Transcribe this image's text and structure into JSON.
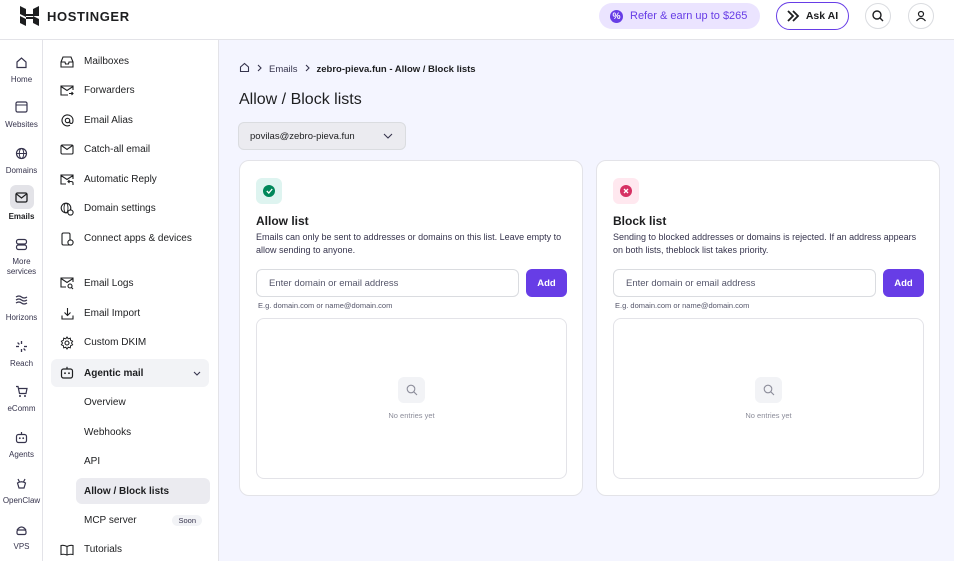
{
  "app": {
    "brand": "HOSTINGER",
    "refer_label": "Refer & earn up to $265",
    "ask_ai_label": "Ask AI",
    "accent": "#673de6"
  },
  "rail": [
    {
      "label": "Home",
      "icon": "home-icon"
    },
    {
      "label": "Websites",
      "icon": "browser-icon"
    },
    {
      "label": "Domains",
      "icon": "globe-icon"
    },
    {
      "label": "Emails",
      "icon": "mail-icon",
      "active": true
    },
    {
      "label": "More services",
      "icon": "server-icon"
    },
    {
      "label": "Horizons",
      "icon": "horizons-icon"
    },
    {
      "label": "Reach",
      "icon": "reach-icon"
    },
    {
      "label": "eComm",
      "icon": "cart-icon"
    },
    {
      "label": "Agents",
      "icon": "robot-icon"
    },
    {
      "label": "OpenClaw",
      "icon": "claw-icon"
    },
    {
      "label": "VPS",
      "icon": "vps-icon"
    }
  ],
  "sidebar": {
    "items": [
      {
        "label": "Mailboxes",
        "icon": "inbox-icon"
      },
      {
        "label": "Forwarders",
        "icon": "forward-mail-icon"
      },
      {
        "label": "Email Alias",
        "icon": "at-icon"
      },
      {
        "label": "Catch-all email",
        "icon": "envelope-icon"
      },
      {
        "label": "Automatic Reply",
        "icon": "reply-icon"
      },
      {
        "label": "Domain settings",
        "icon": "globe-gear-icon"
      },
      {
        "label": "Connect apps & devices",
        "icon": "devices-icon"
      },
      {
        "label": "Email Logs",
        "icon": "mail-search-icon"
      },
      {
        "label": "Email Import",
        "icon": "download-icon"
      },
      {
        "label": "Custom DKIM",
        "icon": "gear-icon"
      }
    ],
    "group": {
      "label": "Agentic mail",
      "icon": "robot-mail-icon"
    },
    "sub_items": [
      {
        "label": "Overview"
      },
      {
        "label": "Webhooks"
      },
      {
        "label": "API"
      },
      {
        "label": "Allow / Block lists",
        "active": true
      },
      {
        "label": "MCP server",
        "badge": "Soon"
      }
    ],
    "tutorials": {
      "label": "Tutorials",
      "icon": "book-icon"
    }
  },
  "breadcrumb": {
    "emails": "Emails",
    "current": "zebro-pieva.fun - Allow / Block lists"
  },
  "page_title": "Allow / Block lists",
  "mailbox_select": {
    "value": "povilas@zebro-pieva.fun"
  },
  "allow": {
    "title": "Allow list",
    "description": "Emails can only be sent to addresses or domains on this list. Leave empty to allow sending to anyone.",
    "placeholder": "Enter domain or email address",
    "add_label": "Add",
    "hint": "E.g. domain.com or name@domain.com",
    "empty": "No entries yet"
  },
  "block": {
    "title": "Block list",
    "description": "Sending to blocked addresses or domains is rejected. If an address appears on both lists, theblock list takes priority.",
    "placeholder": "Enter domain or email address",
    "add_label": "Add",
    "hint": "E.g. domain.com or name@domain.com",
    "empty": "No entries yet"
  }
}
